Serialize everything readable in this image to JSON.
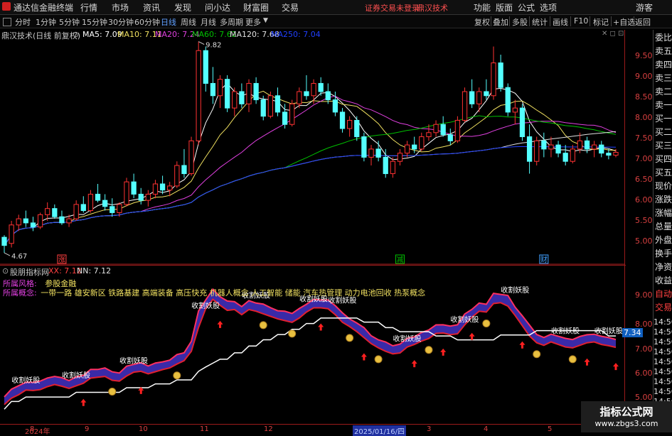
{
  "menubar": {
    "app_title": "通达信金融终端",
    "menu": [
      "行情",
      "市场",
      "资讯",
      "发现",
      "问小达",
      "财富圈",
      "交易"
    ],
    "notice": "证券交易未登录",
    "stock_tag": "鼎汉技术",
    "right_menu": [
      "功能",
      "版面",
      "公式",
      "选项"
    ],
    "guest": "游客"
  },
  "toolbar": {
    "periods": [
      "分时",
      "1分钟",
      "5分钟",
      "15分钟",
      "30分钟",
      "60分钟",
      "日线",
      "周线",
      "月线",
      "多周期",
      "更多"
    ],
    "active_period": "日线",
    "right_tools": [
      "复权",
      "叠加",
      "多股",
      "统计",
      "画线",
      "F10",
      "标记",
      "+自选",
      "返回"
    ]
  },
  "main_info": {
    "stock_label": "鼎汉技术(日线 前复权)",
    "ma": [
      {
        "label": "MA5: 7.09",
        "color": "#ffffff"
      },
      {
        "label": "MA10: 7.11",
        "color": "#f0e060"
      },
      {
        "label": "MA20: 7.24",
        "color": "#e040e0"
      },
      {
        "label": "MA60: 7.62",
        "color": "#00c000"
      },
      {
        "label": "MA120: 7.68",
        "color": "#e0e0e0"
      },
      {
        "label": "MA250: 7.04",
        "color": "#2040ff"
      }
    ]
  },
  "price_axis": [
    "9.50",
    "9.00",
    "8.50",
    "8.00",
    "7.50",
    "7.00",
    "6.50",
    "6.00",
    "5.50",
    "5.00"
  ],
  "high_label": "9.82",
  "low_label": "4.67",
  "markers": [
    {
      "label": "涨",
      "color": "#ff4040"
    },
    {
      "label": "减",
      "color": "#00c000"
    },
    {
      "label": "财",
      "color": "#40a0ff"
    }
  ],
  "sidebar": {
    "top": [
      {
        "t": "委比",
        "c": "#e0e0e0"
      },
      {
        "t": "卖五",
        "c": "#e0e0e0"
      },
      {
        "t": "卖四",
        "c": "#e0e0e0"
      },
      {
        "t": "卖三",
        "c": "#e0e0e0"
      },
      {
        "t": "卖二",
        "c": "#e0e0e0"
      },
      {
        "t": "卖一",
        "c": "#e0e0e0"
      },
      {
        "t": "买一",
        "c": "#e0e0e0"
      },
      {
        "t": "买二",
        "c": "#e0e0e0"
      },
      {
        "t": "买三",
        "c": "#e0e0e0"
      },
      {
        "t": "买四",
        "c": "#e0e0e0"
      },
      {
        "t": "买五",
        "c": "#e0e0e0"
      },
      {
        "t": "现价",
        "c": "#e0e0e0"
      },
      {
        "t": "涨跌",
        "c": "#e0e0e0"
      },
      {
        "t": "涨幅",
        "c": "#e0e0e0"
      },
      {
        "t": "总量",
        "c": "#e0e0e0"
      },
      {
        "t": "外盘",
        "c": "#e0e0e0"
      },
      {
        "t": "换手",
        "c": "#e0e0e0"
      },
      {
        "t": "净资",
        "c": "#e0e0e0"
      },
      {
        "t": "收益",
        "c": "#e0e0e0"
      },
      {
        "t": "自动",
        "c": "#ff4040"
      },
      {
        "t": "交易",
        "c": "#ff4040"
      }
    ],
    "times": [
      "14:56",
      "14:56",
      "14:56",
      "14:56",
      "14:56",
      "14:56",
      "14:56",
      "14:56",
      "14:56",
      "14:56",
      "14:56"
    ]
  },
  "lower_info": {
    "indicator_name": "股朋指标网",
    "xx": "XX: 7.12",
    "nn": "NN: 7.12",
    "style_label": "所属风格:",
    "style_value": "参股金融",
    "concept_label": "所属概念:",
    "concept_value": "一带一路 雄安新区 铁路基建 高端装备 高压快充 机器人概念 人工智能 储能 汽车热管理 动力电池回收 热泵概念"
  },
  "lower_axis": [
    "9.00",
    "8.00",
    "7.00",
    "6.00",
    "5.00"
  ],
  "lower_cur_value": "7.34",
  "sell_label": "收割妖股",
  "date_axis": [
    "2024年",
    "8",
    "9",
    "10",
    "11",
    "12",
    "2025/01/16/四",
    "3",
    "4",
    "5"
  ],
  "watermark": {
    "title": "指标公式网",
    "url": "www.zbgs3.com"
  },
  "chart_data": {
    "type": "candlestick",
    "title": "鼎汉技术(日线 前复权)",
    "ylim": [
      4.6,
      10.0
    ],
    "ohlc": [
      [
        5.05,
        5.1,
        4.67,
        4.85
      ],
      [
        4.9,
        5.45,
        4.8,
        5.35
      ],
      [
        5.35,
        5.6,
        5.2,
        5.5
      ],
      [
        5.5,
        5.7,
        5.3,
        5.4
      ],
      [
        5.4,
        5.55,
        5.2,
        5.3
      ],
      [
        5.3,
        5.65,
        5.25,
        5.6
      ],
      [
        5.6,
        5.9,
        5.45,
        5.75
      ],
      [
        5.75,
        5.85,
        5.5,
        5.55
      ],
      [
        5.55,
        5.7,
        5.35,
        5.4
      ],
      [
        5.4,
        5.6,
        5.3,
        5.5
      ],
      [
        5.5,
        5.95,
        5.45,
        5.85
      ],
      [
        5.85,
        6.05,
        5.65,
        5.7
      ],
      [
        5.7,
        6.2,
        5.65,
        6.1
      ],
      [
        6.1,
        6.35,
        5.9,
        5.95
      ],
      [
        5.95,
        6.1,
        5.7,
        5.8
      ],
      [
        5.8,
        6.0,
        5.55,
        5.65
      ],
      [
        5.65,
        5.9,
        5.55,
        5.85
      ],
      [
        5.85,
        6.5,
        5.8,
        6.4
      ],
      [
        6.4,
        6.6,
        6.0,
        6.1
      ],
      [
        6.1,
        6.25,
        5.85,
        5.95
      ],
      [
        5.95,
        6.2,
        5.8,
        6.1
      ],
      [
        6.1,
        6.45,
        6.0,
        6.35
      ],
      [
        6.35,
        6.55,
        6.1,
        6.2
      ],
      [
        6.2,
        6.4,
        6.05,
        6.3
      ],
      [
        6.3,
        6.9,
        6.25,
        6.8
      ],
      [
        6.8,
        7.2,
        6.5,
        6.6
      ],
      [
        6.6,
        7.5,
        6.55,
        7.4
      ],
      [
        7.4,
        9.82,
        7.3,
        9.6
      ],
      [
        9.6,
        9.7,
        8.6,
        8.8
      ],
      [
        8.8,
        9.2,
        8.3,
        8.5
      ],
      [
        8.5,
        9.0,
        8.2,
        8.9
      ],
      [
        8.9,
        9.0,
        8.1,
        8.2
      ],
      [
        8.2,
        8.7,
        8.0,
        8.6
      ],
      [
        8.6,
        8.8,
        8.2,
        8.3
      ],
      [
        8.3,
        8.9,
        8.1,
        8.8
      ],
      [
        8.8,
        8.95,
        8.3,
        8.4
      ],
      [
        8.4,
        8.5,
        7.9,
        8.0
      ],
      [
        8.0,
        8.6,
        7.95,
        8.5
      ],
      [
        8.5,
        8.7,
        8.0,
        8.1
      ],
      [
        8.1,
        8.3,
        7.7,
        7.8
      ],
      [
        7.8,
        8.4,
        7.75,
        8.3
      ],
      [
        8.3,
        8.7,
        8.2,
        8.6
      ],
      [
        8.6,
        9.0,
        8.4,
        8.5
      ],
      [
        8.5,
        8.9,
        8.3,
        8.8
      ],
      [
        8.8,
        8.95,
        8.5,
        8.6
      ],
      [
        8.6,
        8.8,
        8.3,
        8.4
      ],
      [
        8.4,
        8.6,
        8.0,
        8.1
      ],
      [
        8.1,
        8.2,
        7.6,
        7.7
      ],
      [
        7.7,
        8.0,
        7.5,
        7.9
      ],
      [
        7.9,
        8.0,
        7.4,
        7.5
      ],
      [
        7.5,
        7.6,
        6.9,
        7.0
      ],
      [
        7.0,
        7.3,
        6.8,
        7.2
      ],
      [
        7.2,
        7.4,
        6.9,
        7.0
      ],
      [
        7.0,
        7.2,
        6.5,
        6.6
      ],
      [
        6.6,
        7.0,
        6.5,
        6.9
      ],
      [
        6.9,
        7.2,
        6.8,
        7.1
      ],
      [
        7.1,
        7.4,
        7.0,
        7.3
      ],
      [
        7.3,
        7.5,
        7.1,
        7.2
      ],
      [
        7.2,
        7.6,
        7.15,
        7.5
      ],
      [
        7.5,
        7.8,
        7.4,
        7.6
      ],
      [
        7.6,
        7.9,
        7.5,
        7.8
      ],
      [
        7.8,
        8.0,
        7.5,
        7.55
      ],
      [
        7.55,
        7.7,
        7.3,
        7.4
      ],
      [
        7.4,
        8.0,
        7.35,
        7.9
      ],
      [
        7.9,
        8.7,
        7.85,
        8.6
      ],
      [
        8.6,
        8.9,
        8.2,
        8.3
      ],
      [
        8.3,
        8.7,
        8.1,
        8.6
      ],
      [
        8.6,
        8.9,
        8.4,
        8.5
      ],
      [
        8.5,
        9.7,
        8.4,
        9.3
      ],
      [
        9.3,
        9.5,
        8.6,
        8.7
      ],
      [
        8.7,
        8.8,
        8.0,
        8.1
      ],
      [
        8.1,
        8.4,
        7.8,
        8.2
      ],
      [
        8.2,
        8.3,
        7.4,
        7.5
      ],
      [
        7.5,
        7.8,
        6.6,
        6.9
      ],
      [
        6.9,
        7.5,
        6.8,
        7.4
      ],
      [
        7.4,
        7.6,
        7.0,
        7.2
      ],
      [
        7.2,
        7.5,
        7.0,
        7.3
      ],
      [
        7.3,
        7.4,
        7.0,
        7.1
      ],
      [
        7.1,
        7.3,
        6.8,
        6.9
      ],
      [
        6.9,
        7.3,
        6.85,
        7.2
      ],
      [
        7.2,
        7.6,
        7.1,
        7.4
      ],
      [
        7.4,
        7.5,
        7.1,
        7.2
      ],
      [
        7.2,
        7.4,
        7.0,
        7.3
      ],
      [
        7.3,
        7.4,
        7.0,
        7.1
      ],
      [
        7.1,
        7.2,
        6.95,
        7.05
      ],
      [
        7.05,
        7.2,
        7.0,
        7.12
      ]
    ]
  }
}
